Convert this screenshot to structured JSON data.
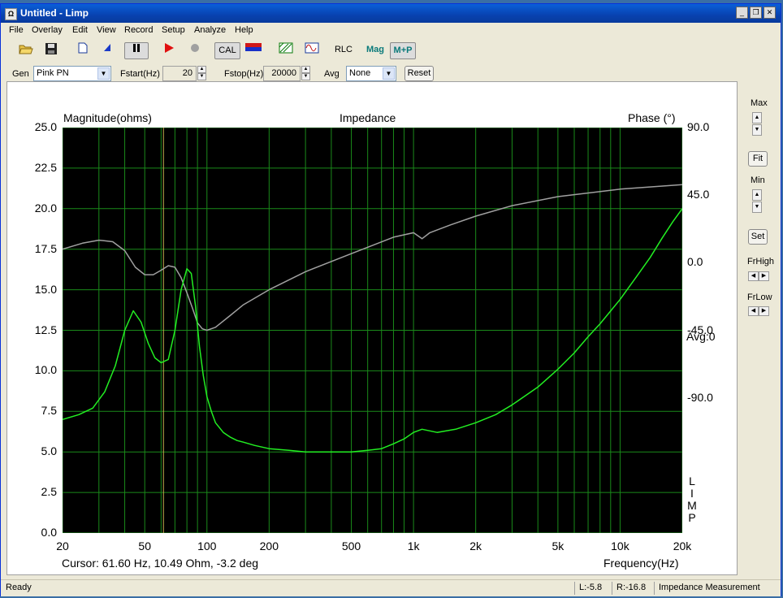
{
  "window": {
    "title": "Untitled - Limp",
    "app_icon": "Ω"
  },
  "menu": [
    "File",
    "Overlay",
    "Edit",
    "View",
    "Record",
    "Setup",
    "Analyze",
    "Help"
  ],
  "toolbar": {
    "cal_label": "CAL",
    "rlc_label": "RLC",
    "mag_label": "Mag",
    "mp_label": "M+P"
  },
  "generator": {
    "gen_label": "Gen",
    "gen_value": "Pink PN",
    "fstart_label": "Fstart(Hz)",
    "fstart_value": "20",
    "fstop_label": "Fstop(Hz)",
    "fstop_value": "20000",
    "avg_label": "Avg",
    "avg_value": "None",
    "reset_label": "Reset"
  },
  "sidebar": {
    "max_label": "Max",
    "fit_label": "Fit",
    "min_label": "Min",
    "set_label": "Set",
    "frhigh_label": "FrHigh",
    "frlow_label": "FrLow"
  },
  "status": {
    "ready": "Ready",
    "left": "L:-5.8",
    "right": "R:-16.8",
    "mode": "Impedance Measurement"
  },
  "colors": {
    "magnitude": "#22ee22",
    "phase": "#a0a0a0",
    "grid": "#1a8a1a",
    "cursor": "#c8b050",
    "plot_bg": "#000000"
  },
  "chart_data": {
    "type": "line",
    "title": "Impedance",
    "ylabel_left": "Magnitude(ohms)",
    "ylabel_right": "Phase (°)",
    "xlabel": "Frequency(Hz)",
    "x_scale": "log",
    "xlim": [
      20,
      20000
    ],
    "ylim_left": [
      0,
      25
    ],
    "ylim_right": [
      -180,
      90
    ],
    "grid": true,
    "y_ticks_left": [
      "25.0",
      "22.5",
      "20.0",
      "17.5",
      "15.0",
      "12.5",
      "10.0",
      "7.5",
      "5.0",
      "2.5",
      "0.0"
    ],
    "y_ticks_right": [
      "90.0",
      "45.0",
      "0.0",
      "-45.0",
      "-90.0"
    ],
    "x_ticks": [
      {
        "v": 20,
        "label": "20"
      },
      {
        "v": 50,
        "label": "50"
      },
      {
        "v": 100,
        "label": "100"
      },
      {
        "v": 200,
        "label": "200"
      },
      {
        "v": 500,
        "label": "500"
      },
      {
        "v": 1000,
        "label": "1k"
      },
      {
        "v": 2000,
        "label": "2k"
      },
      {
        "v": 5000,
        "label": "5k"
      },
      {
        "v": 10000,
        "label": "10k"
      },
      {
        "v": 20000,
        "label": "20k"
      }
    ],
    "avg_label": "Avg:0",
    "watermark": [
      "L",
      "I",
      "M",
      "P"
    ],
    "cursor": {
      "freq": 61.6,
      "text": "Cursor: 61.60 Hz, 10.49 Ohm, -3.2 deg"
    },
    "series": [
      {
        "name": "Magnitude",
        "x": [
          20,
          24,
          28,
          32,
          36,
          40,
          44,
          48,
          52,
          56,
          60,
          65,
          70,
          75,
          80,
          84,
          88,
          92,
          96,
          100,
          105,
          110,
          120,
          130,
          140,
          150,
          170,
          200,
          250,
          300,
          350,
          400,
          500,
          600,
          700,
          800,
          900,
          1000,
          1100,
          1300,
          1600,
          2000,
          2500,
          3000,
          4000,
          5000,
          6000,
          7000,
          8000,
          10000,
          12000,
          14000,
          16000,
          18000,
          20000
        ],
        "y": [
          7.0,
          7.3,
          7.7,
          8.7,
          10.3,
          12.5,
          13.7,
          13.0,
          11.7,
          10.8,
          10.5,
          10.7,
          12.5,
          15.0,
          16.3,
          16.0,
          14.0,
          11.5,
          9.7,
          8.4,
          7.5,
          6.8,
          6.2,
          5.9,
          5.7,
          5.6,
          5.4,
          5.2,
          5.1,
          5.0,
          5.0,
          5.0,
          5.0,
          5.1,
          5.2,
          5.5,
          5.8,
          6.2,
          6.4,
          6.2,
          6.4,
          6.8,
          7.3,
          7.9,
          9.0,
          10.1,
          11.1,
          12.1,
          12.9,
          14.4,
          15.8,
          17.0,
          18.2,
          19.2,
          20.0
        ]
      },
      {
        "name": "Phase",
        "x": [
          20,
          25,
          30,
          35,
          40,
          45,
          50,
          55,
          60,
          65,
          70,
          75,
          80,
          85,
          90,
          95,
          100,
          110,
          130,
          150,
          200,
          300,
          500,
          800,
          1000,
          1100,
          1200,
          1500,
          2000,
          3000,
          5000,
          10000,
          20000
        ],
        "y": [
          9,
          13,
          15,
          14,
          8,
          -3,
          -8,
          -8,
          -5,
          -2,
          -3,
          -10,
          -20,
          -30,
          -40,
          -44,
          -45,
          -43,
          -35,
          -28,
          -18,
          -6,
          6,
          17,
          20,
          16,
          20,
          25,
          31,
          38,
          44,
          49,
          52
        ]
      }
    ]
  }
}
